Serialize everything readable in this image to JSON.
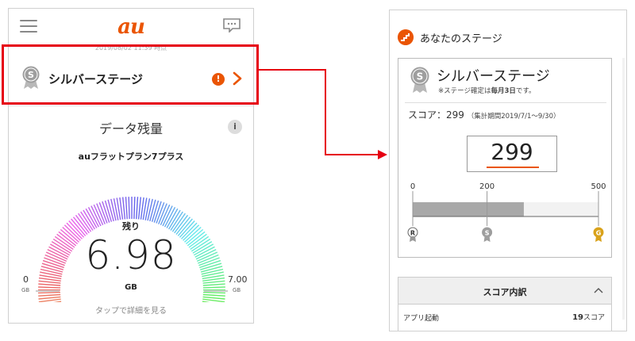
{
  "left_screen": {
    "brand": "au",
    "timestamp": "2019/08/02 11:39 時点",
    "stage_row": {
      "label": "シルバーステージ",
      "medal_letter": "S",
      "alert": "!"
    },
    "data_title": "データ残量",
    "info": "i",
    "plan_name": "auフラットプラン7プラス",
    "gauge": {
      "remain_label": "残り",
      "value": "6.98",
      "unit": "GB",
      "min": "0",
      "min_unit": "GB",
      "max": "7.00",
      "max_unit": "GB",
      "fraction": 0.997
    },
    "tap_hint": "タップで詳細を見る"
  },
  "right_screen": {
    "header_title": "あなたのステージ",
    "card": {
      "medal_letter": "S",
      "stage_name": "シルバーステージ",
      "note_prefix": "※ステージ確定は",
      "note_bold": "毎月3日",
      "note_suffix": "です。",
      "score_label": "スコア：299",
      "period": "（集計期間2019/7/1～9/30）",
      "score": "299",
      "scale": {
        "ticks": [
          "0",
          "200",
          "500"
        ],
        "max": 500,
        "value": 299,
        "markers": [
          {
            "letter": "R",
            "at": 0
          },
          {
            "letter": "S",
            "at": 200
          },
          {
            "letter": "G",
            "at": 500
          }
        ]
      }
    },
    "breakdown": {
      "title": "スコア内訳",
      "rows": [
        {
          "label": "アプリ起動",
          "value": "19",
          "unit": "スコア"
        }
      ]
    }
  },
  "colors": {
    "brand_orange": "#ea5504",
    "highlight_red": "#e60012",
    "silver": "#9e9e9e",
    "gold": "#d9a21b"
  }
}
